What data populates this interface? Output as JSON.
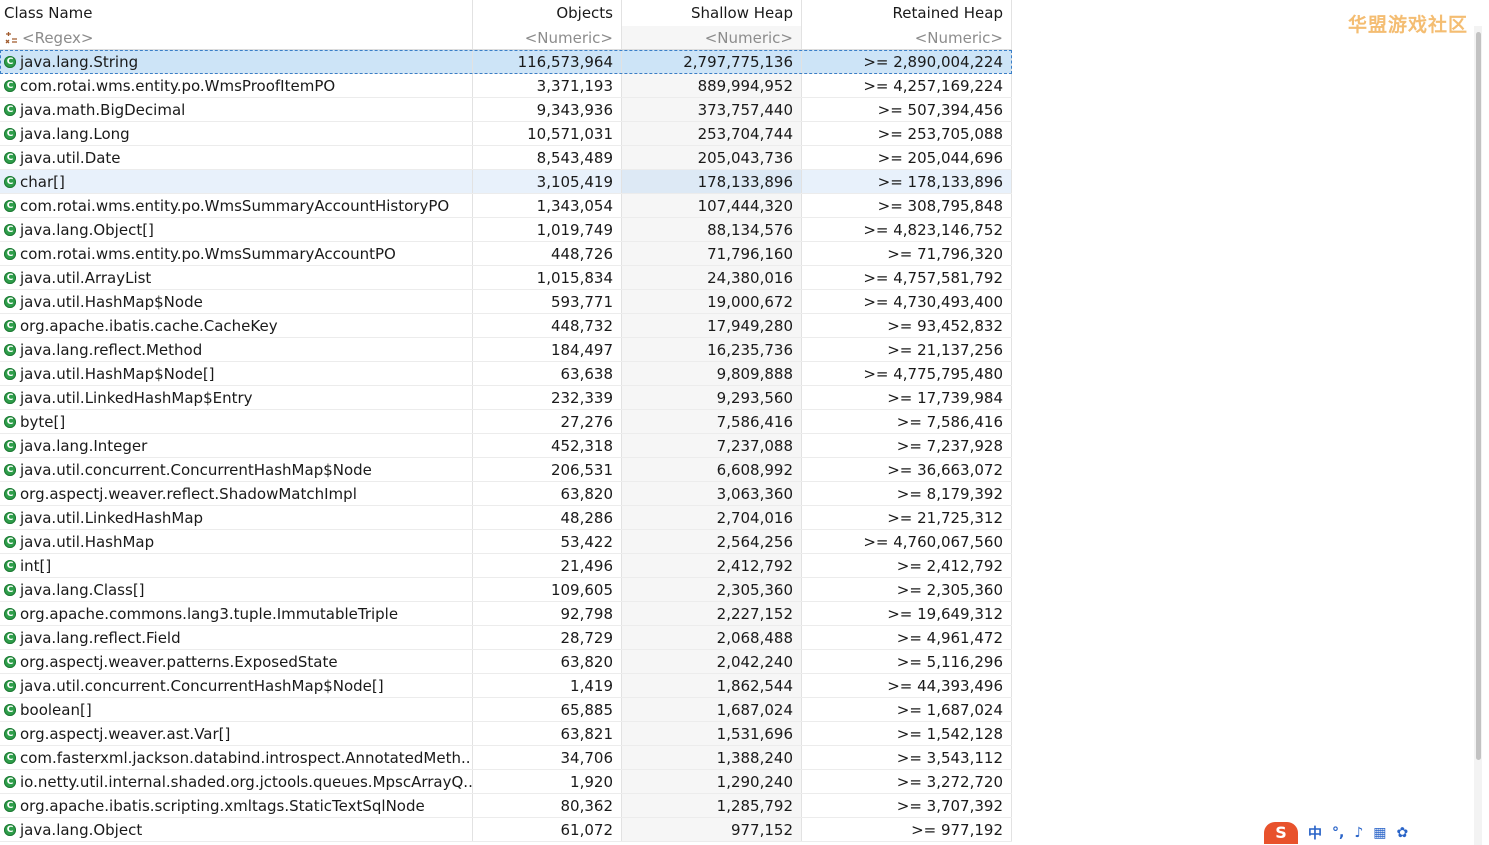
{
  "columns": {
    "class_name": "Class Name",
    "objects": "Objects",
    "shallow_heap": "Shallow Heap",
    "retained_heap": "Retained Heap"
  },
  "filters": {
    "class_name": "<Regex>",
    "objects": "<Numeric>",
    "shallow_heap": "<Numeric>",
    "retained_heap": "<Numeric>"
  },
  "rows": [
    {
      "name": "java.lang.String",
      "objects": "116,573,964",
      "shallow": "2,797,775,136",
      "retained": ">= 2,890,004,224"
    },
    {
      "name": "com.rotai.wms.entity.po.WmsProofItemPO",
      "objects": "3,371,193",
      "shallow": "889,994,952",
      "retained": ">= 4,257,169,224"
    },
    {
      "name": "java.math.BigDecimal",
      "objects": "9,343,936",
      "shallow": "373,757,440",
      "retained": ">= 507,394,456"
    },
    {
      "name": "java.lang.Long",
      "objects": "10,571,031",
      "shallow": "253,704,744",
      "retained": ">= 253,705,088"
    },
    {
      "name": "java.util.Date",
      "objects": "8,543,489",
      "shallow": "205,043,736",
      "retained": ">= 205,044,696"
    },
    {
      "name": "char[]",
      "objects": "3,105,419",
      "shallow": "178,133,896",
      "retained": ">= 178,133,896"
    },
    {
      "name": "com.rotai.wms.entity.po.WmsSummaryAccountHistoryPO",
      "objects": "1,343,054",
      "shallow": "107,444,320",
      "retained": ">= 308,795,848"
    },
    {
      "name": "java.lang.Object[]",
      "objects": "1,019,749",
      "shallow": "88,134,576",
      "retained": ">= 4,823,146,752"
    },
    {
      "name": "com.rotai.wms.entity.po.WmsSummaryAccountPO",
      "objects": "448,726",
      "shallow": "71,796,160",
      "retained": ">= 71,796,320"
    },
    {
      "name": "java.util.ArrayList",
      "objects": "1,015,834",
      "shallow": "24,380,016",
      "retained": ">= 4,757,581,792"
    },
    {
      "name": "java.util.HashMap$Node",
      "objects": "593,771",
      "shallow": "19,000,672",
      "retained": ">= 4,730,493,400"
    },
    {
      "name": "org.apache.ibatis.cache.CacheKey",
      "objects": "448,732",
      "shallow": "17,949,280",
      "retained": ">= 93,452,832"
    },
    {
      "name": "java.lang.reflect.Method",
      "objects": "184,497",
      "shallow": "16,235,736",
      "retained": ">= 21,137,256"
    },
    {
      "name": "java.util.HashMap$Node[]",
      "objects": "63,638",
      "shallow": "9,809,888",
      "retained": ">= 4,775,795,480"
    },
    {
      "name": "java.util.LinkedHashMap$Entry",
      "objects": "232,339",
      "shallow": "9,293,560",
      "retained": ">= 17,739,984"
    },
    {
      "name": "byte[]",
      "objects": "27,276",
      "shallow": "7,586,416",
      "retained": ">= 7,586,416"
    },
    {
      "name": "java.lang.Integer",
      "objects": "452,318",
      "shallow": "7,237,088",
      "retained": ">= 7,237,928"
    },
    {
      "name": "java.util.concurrent.ConcurrentHashMap$Node",
      "objects": "206,531",
      "shallow": "6,608,992",
      "retained": ">= 36,663,072"
    },
    {
      "name": "org.aspectj.weaver.reflect.ShadowMatchImpl",
      "objects": "63,820",
      "shallow": "3,063,360",
      "retained": ">= 8,179,392"
    },
    {
      "name": "java.util.LinkedHashMap",
      "objects": "48,286",
      "shallow": "2,704,016",
      "retained": ">= 21,725,312"
    },
    {
      "name": "java.util.HashMap",
      "objects": "53,422",
      "shallow": "2,564,256",
      "retained": ">= 4,760,067,560"
    },
    {
      "name": "int[]",
      "objects": "21,496",
      "shallow": "2,412,792",
      "retained": ">= 2,412,792"
    },
    {
      "name": "java.lang.Class[]",
      "objects": "109,605",
      "shallow": "2,305,360",
      "retained": ">= 2,305,360"
    },
    {
      "name": "org.apache.commons.lang3.tuple.ImmutableTriple",
      "objects": "92,798",
      "shallow": "2,227,152",
      "retained": ">= 19,649,312"
    },
    {
      "name": "java.lang.reflect.Field",
      "objects": "28,729",
      "shallow": "2,068,488",
      "retained": ">= 4,961,472"
    },
    {
      "name": "org.aspectj.weaver.patterns.ExposedState",
      "objects": "63,820",
      "shallow": "2,042,240",
      "retained": ">= 5,116,296"
    },
    {
      "name": "java.util.concurrent.ConcurrentHashMap$Node[]",
      "objects": "1,419",
      "shallow": "1,862,544",
      "retained": ">= 44,393,496"
    },
    {
      "name": "boolean[]",
      "objects": "65,885",
      "shallow": "1,687,024",
      "retained": ">= 1,687,024"
    },
    {
      "name": "org.aspectj.weaver.ast.Var[]",
      "objects": "63,821",
      "shallow": "1,531,696",
      "retained": ">= 1,542,128"
    },
    {
      "name": "com.fasterxml.jackson.databind.introspect.AnnotatedMeth...",
      "objects": "34,706",
      "shallow": "1,388,240",
      "retained": ">= 3,543,112"
    },
    {
      "name": "io.netty.util.internal.shaded.org.jctools.queues.MpscArrayQ...",
      "objects": "1,920",
      "shallow": "1,290,240",
      "retained": ">= 3,272,720"
    },
    {
      "name": "org.apache.ibatis.scripting.xmltags.StaticTextSqlNode",
      "objects": "80,362",
      "shallow": "1,285,792",
      "retained": ">= 3,707,392"
    },
    {
      "name": "java.lang.Object",
      "objects": "61,072",
      "shallow": "977,152",
      "retained": ">= 977,192"
    }
  ],
  "watermark": "华盟游戏社区",
  "ime": {
    "logo": "S",
    "lang": "中"
  },
  "icons": {
    "class": "class-icon",
    "regex": "regex-filter-icon"
  },
  "colors": {
    "selection": "#cde4f7",
    "secondary_selection": "#e8f1fb",
    "class_icon": "#2e9e4a"
  }
}
